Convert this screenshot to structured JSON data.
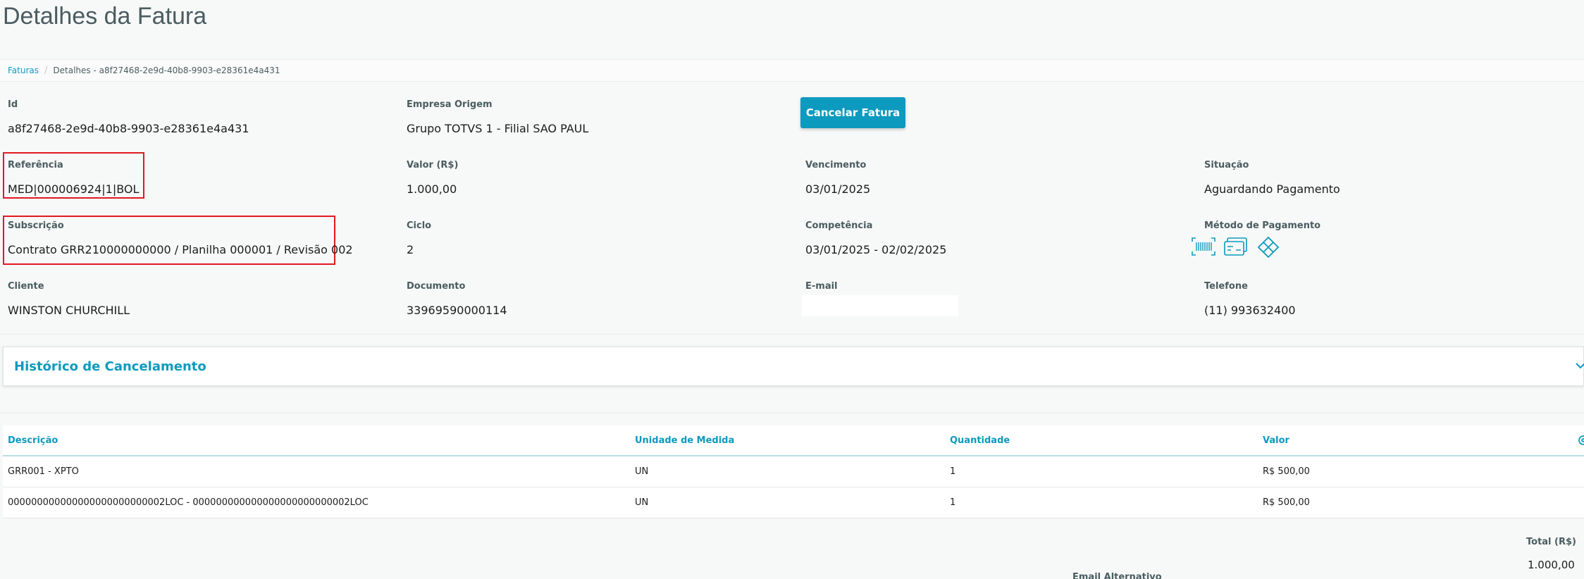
{
  "page": {
    "title": "Detalhes da Fatura"
  },
  "breadcrumb": {
    "link": "Faturas",
    "current": "Detalhes - a8f27468-2e9d-40b8-9903-e28361e4a431"
  },
  "actions": {
    "cancel_label": "Cancelar Fatura"
  },
  "fields": {
    "id": {
      "label": "Id",
      "value": "a8f27468-2e9d-40b8-9903-e28361e4a431"
    },
    "empresa": {
      "label": "Empresa Origem",
      "value": "Grupo TOTVS 1 - Filial SAO PAUL"
    },
    "referencia": {
      "label": "Referência",
      "value": "MED|000006924|1|BOL"
    },
    "valor": {
      "label": "Valor (R$)",
      "value": "1.000,00"
    },
    "vencimento": {
      "label": "Vencimento",
      "value": "03/01/2025"
    },
    "situacao": {
      "label": "Situação",
      "value": "Aguardando Pagamento"
    },
    "subscricao": {
      "label": "Subscrição",
      "value": "Contrato GRR210000000000 / Planilha 000001 / Revisão 002"
    },
    "ciclo": {
      "label": "Ciclo",
      "value": "2"
    },
    "competencia": {
      "label": "Competência",
      "value": "03/01/2025 - 02/02/2025"
    },
    "metodo": {
      "label": "Método de Pagamento",
      "icons": [
        "barcode-icon",
        "credit-card-icon",
        "pix-icon"
      ]
    },
    "cliente": {
      "label": "Cliente",
      "value": "WINSTON CHURCHILL"
    },
    "documento": {
      "label": "Documento",
      "value": "33969590000114"
    },
    "email": {
      "label": "E-mail",
      "value": ""
    },
    "telefone": {
      "label": "Telefone",
      "value": "(11) 993632400"
    }
  },
  "historico": {
    "title": "Histórico de Cancelamento"
  },
  "table": {
    "headers": [
      "Descrição",
      "Unidade de Medida",
      "Quantidade",
      "Valor"
    ],
    "rows": [
      [
        "GRR001 - XPTO",
        "UN",
        "1",
        "R$ 500,00"
      ],
      [
        "000000000000000000000000002LOC - 000000000000000000000000002LOC",
        "UN",
        "1",
        "R$ 500,00"
      ]
    ]
  },
  "totals": {
    "label": "Total (R$)",
    "value": "1.000,00"
  },
  "email_alternativo": {
    "label": "Email Alternativo"
  },
  "colors": {
    "accent": "#0c9abe",
    "highlight": "#e0191f",
    "label": "#4a5c60"
  }
}
